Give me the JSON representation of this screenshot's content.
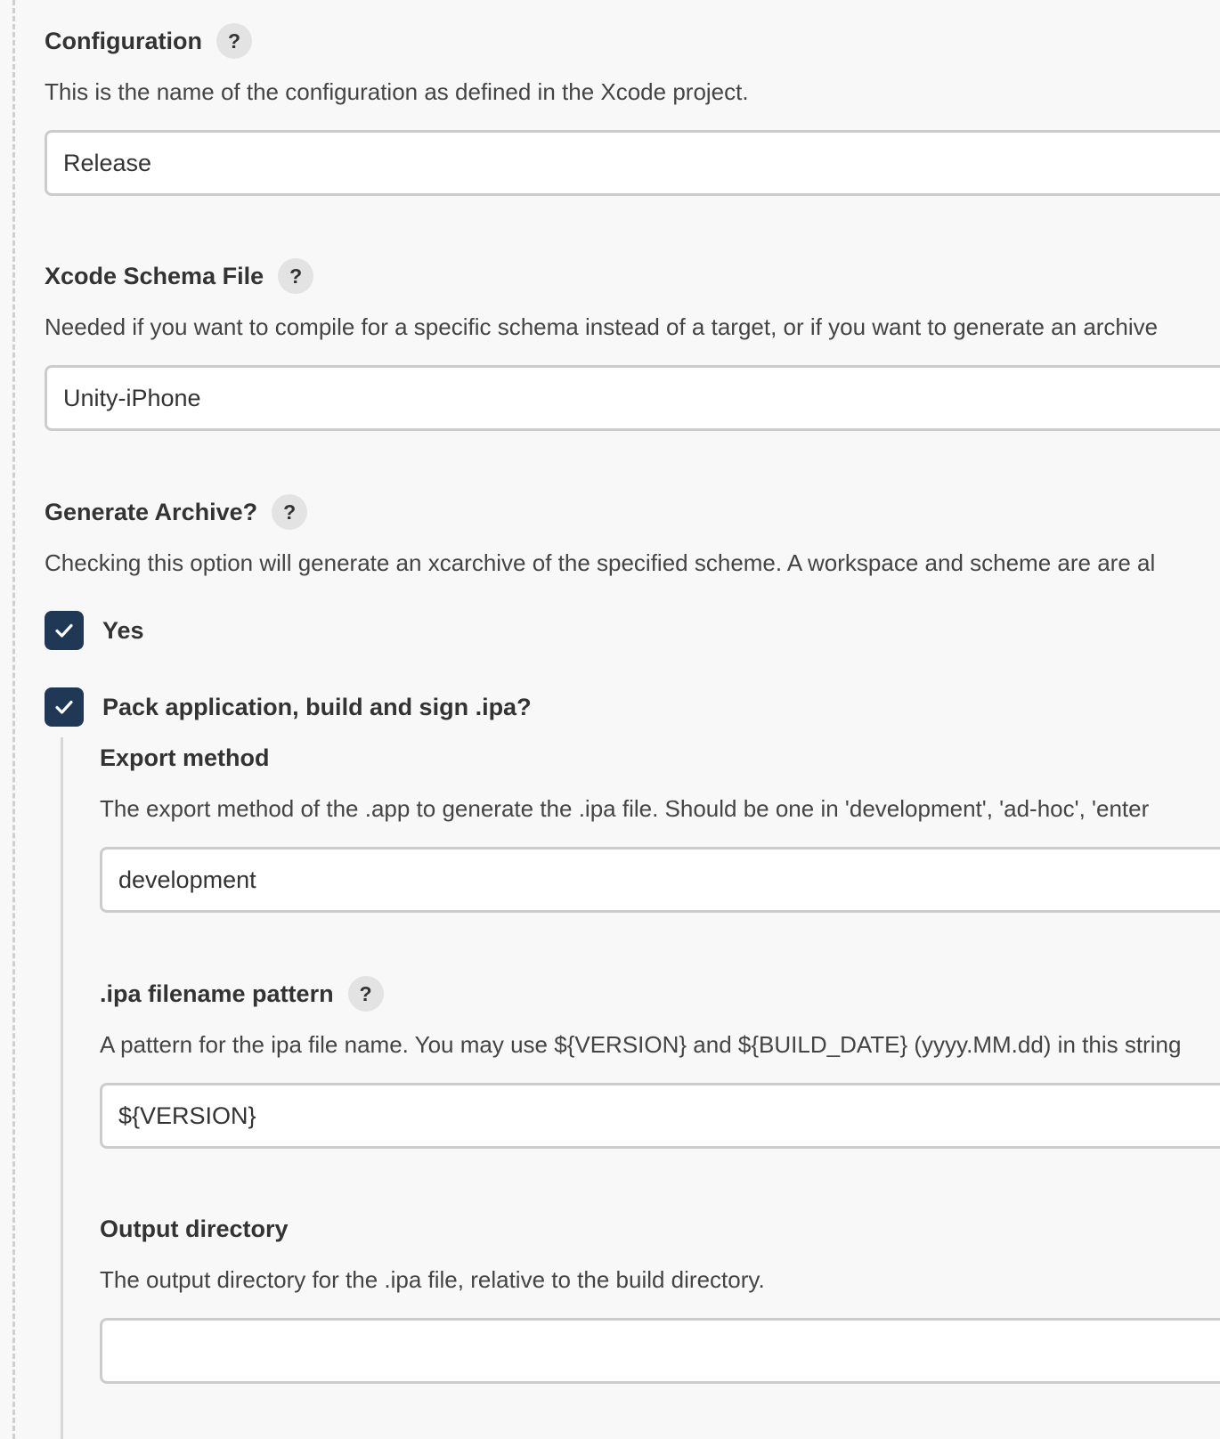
{
  "configuration": {
    "label": "Configuration",
    "help": "?",
    "description": "This is the name of the configuration as defined in the Xcode project.",
    "value": "Release"
  },
  "schema_file": {
    "label": "Xcode Schema File",
    "help": "?",
    "description": "Needed if you want to compile for a specific schema instead of a target, or if you want to generate an archive",
    "value": "Unity-iPhone"
  },
  "generate_archive": {
    "label": "Generate Archive?",
    "help": "?",
    "description": "Checking this option will generate an xcarchive of the specified scheme. A workspace and scheme are are al",
    "checkbox_label": "Yes",
    "checked": true
  },
  "pack_ipa": {
    "checkbox_label": "Pack application, build and sign .ipa?",
    "checked": true
  },
  "export_method": {
    "label": "Export method",
    "description": "The export method of the .app to generate the .ipa file. Should be one in 'development', 'ad-hoc', 'enter",
    "value": "development"
  },
  "ipa_filename": {
    "label": ".ipa filename pattern",
    "help": "?",
    "description": "A pattern for the ipa file name. You may use ${VERSION} and ${BUILD_DATE} (yyyy.MM.dd) in this string",
    "value": "${VERSION}"
  },
  "output_directory": {
    "label": "Output directory",
    "description": "The output directory for the .ipa file, relative to the build directory.",
    "value": ""
  },
  "colors": {
    "checkbox": "#1e3856",
    "background": "#f8f8f8"
  }
}
